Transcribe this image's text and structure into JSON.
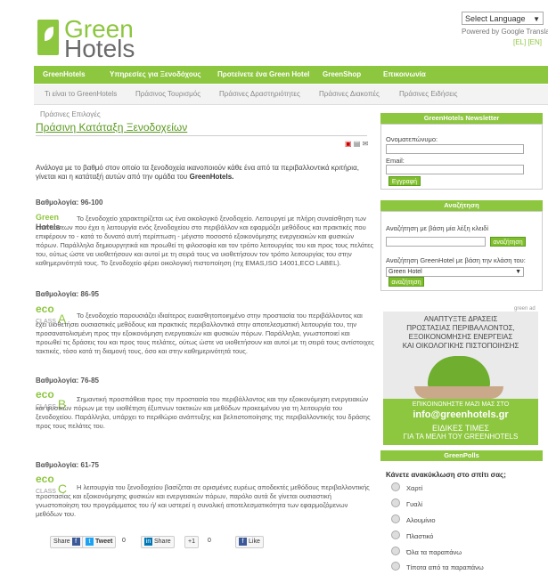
{
  "header": {
    "logo_line1": "Green",
    "logo_line2": "Hotels",
    "language_select": "Select Language",
    "powered_by": "Powered by Google Translate",
    "lang_links": "[EL] [EN]"
  },
  "nav": [
    "GreenHotels",
    "Υπηρεσίες για Ξενοδόχους",
    "Προτείνετε ένα Green Hotel",
    "GreenShop",
    "Επικοινωνία"
  ],
  "subnav": [
    "Τι είναι το GreenHotels",
    "Πράσινος Τουρισμός",
    "Πράσινες Δραστηριότητες",
    "Πράσινες Διακοπές",
    "Πράσινες Ειδήσεις"
  ],
  "main": {
    "breadcrumb": "Πράσινες Επιλογές",
    "title": "Πράσινη Κατάταξη Ξενοδοχείων",
    "intro_text": "Ανάλογα με το βαθμό στον οποίο τα ξενοδοχεία ικανοποιούν κάθε ένα από τα περιβαλλοντικά κριτήρια, γίνεται και η κατάταξή αυτών από την ομάδα του",
    "intro_brand": "GreenHotels.",
    "ratings": [
      {
        "score": "Βαθμολογία: 96-100",
        "logo": "Green Hotels",
        "text": "Το ξενοδοχείο χαρακτηρίζεται ως ένα οικολογικό ξενοδοχείο. Λειτουργεί με πλήρη συναίσθηση των επιπτώσεων που έχει η λειτουργία ενός ξενοδοχείου στο περιβάλλον και εφαρμόζει μεθόδους και πρακτικές που επιφέρουν το - κατά το δυνατό αυτή περίπτωση - μέγιστο ποσοστό εξοικονόμησης ενεργειακών και φυσικών πόρων. Παράλληλα δημιουργητικά και προωθεί τη φιλοσοφία και τον τρόπο λειτουργίας του και προς τους πελάτες του, ούτως ώστε να υιοθετήσουν και αυτοί με τη σειρά τους να υιοθετήσουν τον τρόπο λειτουργίας του στην καθημερινότητά τους. Το ξενοδοχείο φέρει οικολογική πιστοποίηση (πχ EMAS,ISO 14001,ECO LABEL)."
      },
      {
        "score": "Βαθμολογία: 86-95",
        "logo": "eco CLASS A",
        "text": "Το ξενοδοχείο παρουσιάζει ιδιαίτερος ευαισθητοποιημένο στην προστασία του περιβάλλοντος και έχει υιοθετήσει ουσιαστικές μεθόδους και πρακτικές περιβαλλοντικά στην αποτελεσματική λειτουργία του, την προσανατολισμένη προς την εξοικονόμηση ενεργειακών και φυσικών πόρων. Παράλληλα, γνωστοποιεί και προωθεί τις δράσεις του και προς τους πελάτες, ούτως ώστε να υιοθετήσουν και αυτοί με τη σειρά τους αντίστοιχες τακτικές, τόσο κατά τη διαμονή τους, όσο και στην καθημερινότητά τους."
      },
      {
        "score": "Βαθμολογία: 76-85",
        "logo": "eco CLASS B",
        "text": "Σημαντική προσπάθεια προς την προστασία του περιβάλλοντος και την εξοικονόμηση ενεργειακών και φυσικών πόρων με την υιοθέτηση έξυπνων τακτικών και μεθόδων προκειμένου για τη λειτουργία του ξενοδοχείου. Παράλληλα, υπάρχει το περιθώριο ανάπτυξης και βελτιστοποίησης της περιβαλλοντικής του δράσης προς τους πελάτες του."
      },
      {
        "score": "Βαθμολογία: 61-75",
        "logo": "eco CLASS C",
        "text": "Η λειτουργία του ξενοδοχείου βασίζεται σε ορισμένες ευρέως αποδεκτές μεθόδους περιβαλλοντικής προστασίας και εξοικονόμησης φυσικών και ενεργειακών πόρων, παρόλο αυτά δε γίνεται ουσιαστική γνωστοποίηση του προγράμματος του ή/ και υστερεί η συνολική αποτελεσματικότητα των εφαρμοζόμενων μεθόδων του."
      }
    ],
    "share": {
      "share_label": "Share",
      "tweet_label": "Tweet",
      "tweet_count": "0",
      "linkedin_label": "Share",
      "plus_label": "+1",
      "plus_count": "0",
      "like_label": "Like"
    }
  },
  "sidebar": {
    "newsletter": {
      "header": "GreenHotels Newsletter",
      "name_label": "Ονοματεπώνυμο:",
      "email_label": "Email:",
      "submit": "Εγγραφή"
    },
    "search": {
      "header": "Αναζήτηση",
      "keyword_label": "Αναζήτηση με βάση μία λέξη κλειδί",
      "keyword_button": "αναζήτηση",
      "class_label": "Αναζήτηση GreenHotel με βάση την κλάση του:",
      "class_selected": "Green Hotel",
      "class_button": "αναζήτηση"
    },
    "ad": {
      "label": "green ad",
      "lines": [
        "ΑΝΑΠΤΥΞΤΕ ΔΡΑΣΕΙΣ",
        "ΠΡΟΣΤΑΣΙΑΣ ΠΕΡΙΒΑΛΛΟΝΤΟΣ,",
        "ΕΞΟΙΚΟΝΟΜΗΣΗΣ ΕΝΕΡΓΕΙΑΣ",
        "ΚΑΙ ΟΙΚΟΛΟΓΙΚΗΣ ΠΙΣΤΟΠΟΙΗΣΗΣ"
      ],
      "contact": "ΕΠΙΚΟΙΝΩΝΗΣΤΕ ΜΑΖΙ ΜΑΣ ΣΤΟ",
      "email": "info@greenhotels.gr",
      "offer1": "ΕΙΔΙΚΕΣ ΤΙΜΕΣ",
      "offer2": "ΓΙΑ ΤΑ ΜΕΛΗ ΤΟΥ GREENHOTELS"
    },
    "poll": {
      "header": "GreenPolls",
      "question": "Κάνετε ανακύκλωση στο σπίτι σας;",
      "options": [
        "Χαρτί",
        "Γυαλί",
        "Αλουμίνιο",
        "Πλαστικό",
        "Όλα τα παραπάνω",
        "Τίποτα από τα παραπάνω"
      ]
    }
  }
}
